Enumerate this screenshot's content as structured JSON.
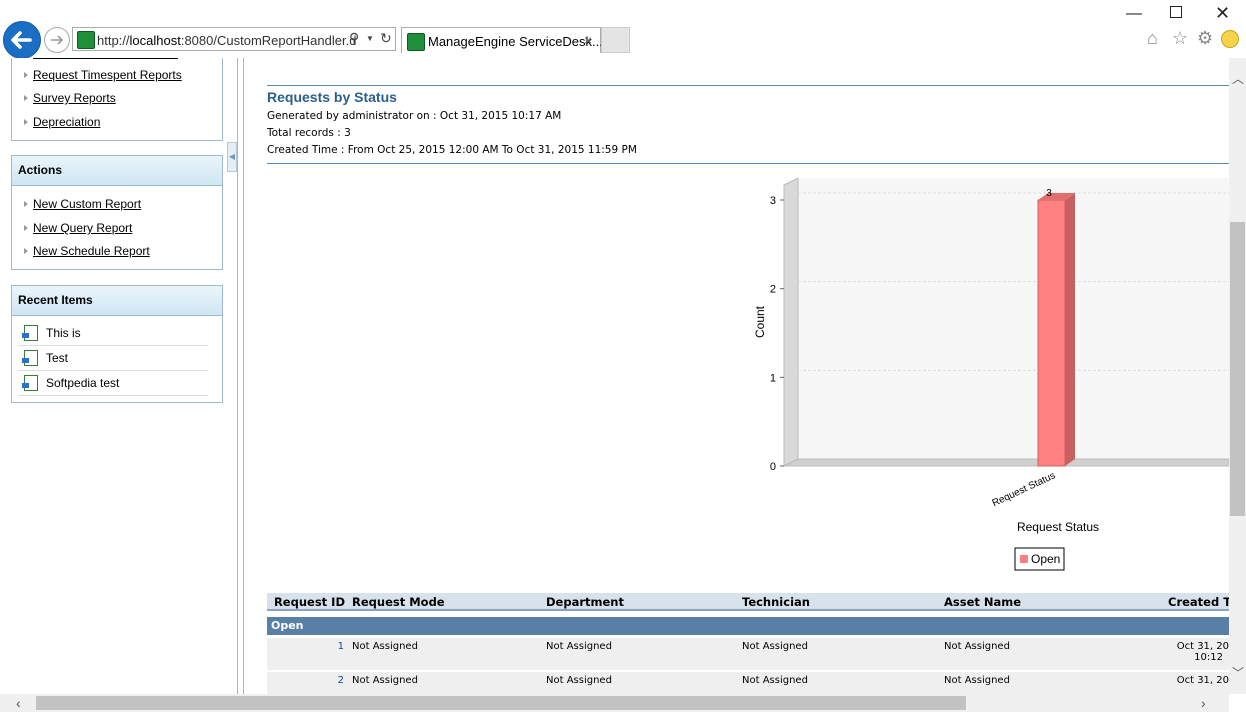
{
  "browser": {
    "url_prefix": "http://",
    "url_host": "localhost",
    "url_rest": ":8080/CustomReportHandler.d",
    "tab_title": "ManageEngine ServiceDesk...",
    "tab_close": "×"
  },
  "sidebar": {
    "reports_links": [
      "Request Timespent Reports",
      "Survey Reports",
      "Depreciation"
    ],
    "actions": {
      "title": "Actions",
      "links": [
        "New Custom Report",
        "New Query Report",
        "New Schedule Report"
      ]
    },
    "recent": {
      "title": "Recent Items",
      "items": [
        "This is",
        "Test",
        "Softpedia test"
      ]
    }
  },
  "report": {
    "title": "Requests by Status",
    "generated": "Generated by administrator  on : Oct 31, 2015 10:17 AM",
    "total": "Total records : 3",
    "created": "Created Time : From Oct 25, 2015 12:00 AM To Oct 31, 2015 11:59 PM"
  },
  "chart_data": {
    "type": "bar",
    "categories": [
      "Request Status"
    ],
    "series": [
      {
        "name": "Open",
        "values": [
          3
        ]
      }
    ],
    "ylabel": "Count",
    "xlabel": "Request Status",
    "ylim": [
      0,
      3
    ],
    "yticks": [
      "0",
      "1",
      "2",
      "3"
    ],
    "data_labels": [
      "3"
    ],
    "bar_color": "#ff8080",
    "legend_position": "bottom",
    "grid": true
  },
  "table": {
    "columns": [
      "Request ID",
      "Request Mode",
      "Department",
      "Technician",
      "Asset Name",
      "Created Ti"
    ],
    "group": "Open",
    "rows": [
      {
        "id": "1",
        "mode": "Not Assigned",
        "dept": "Not Assigned",
        "tech": "Not Assigned",
        "asset": "Not Assigned",
        "created1": "Oct 31, 20",
        "created2": "10:12"
      },
      {
        "id": "2",
        "mode": "Not Assigned",
        "dept": "Not Assigned",
        "tech": "Not Assigned",
        "asset": "Not Assigned",
        "created1": "Oct 31, 20",
        "created2": ""
      }
    ]
  },
  "colors": {
    "accent": "#2a5f8f",
    "header_bg": "#d8e2ec",
    "group_bg": "#5a7fa6",
    "back_button": "#1a6fc4"
  }
}
